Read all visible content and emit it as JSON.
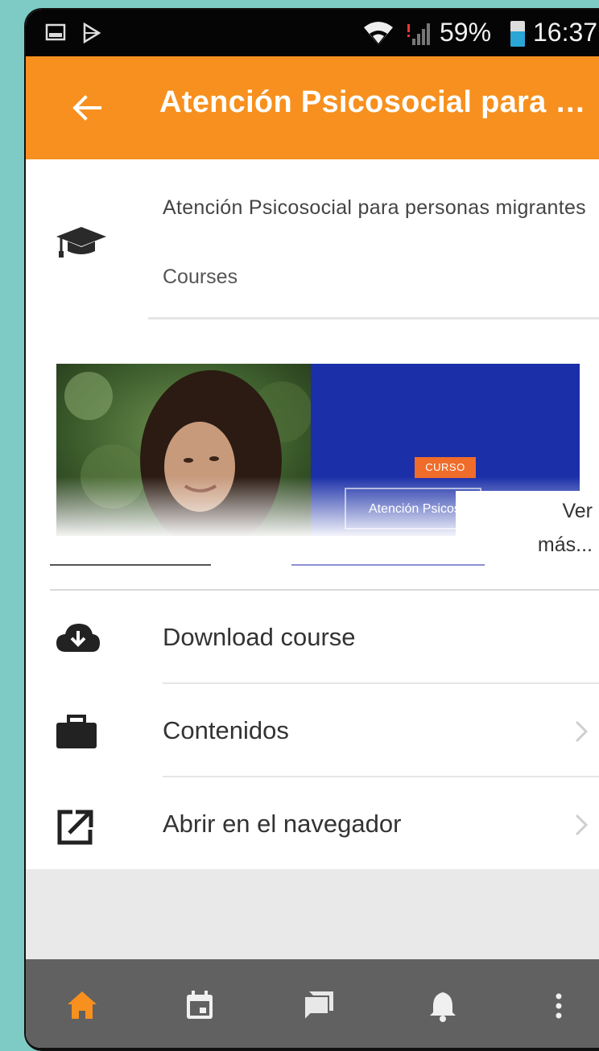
{
  "status_bar": {
    "battery_percent": "59%",
    "time": "16:37",
    "icons": [
      "gallery-icon",
      "play-store-icon",
      "wifi-icon",
      "signal-icon",
      "battery-icon"
    ]
  },
  "app_bar": {
    "back_icon": "arrow-left-icon",
    "title": "Atención Psicosocial para personas migrantes"
  },
  "course": {
    "icon": "graduation-cap-icon",
    "name": "Atención Psicosocial para personas migrantes",
    "category": "Courses"
  },
  "banner": {
    "badge": "CURSO",
    "caption": "Atención Psicosocial",
    "see_more": "Ver más..."
  },
  "list": {
    "items": [
      {
        "label": "Download course",
        "icon": "cloud-download-icon"
      },
      {
        "label": "Contenidos",
        "icon": "briefcase-icon"
      },
      {
        "label": "Abrir en el navegador",
        "icon": "external-link-icon"
      }
    ]
  },
  "bottom_nav": {
    "items": [
      "home-icon",
      "calendar-icon",
      "messages-icon",
      "notifications-icon",
      "more-icon"
    ]
  },
  "colors": {
    "app_bar": "#f7901e",
    "bottom_nav": "#616161",
    "active_nav": "#f7901e",
    "banner_blue": "#1b2fa8",
    "background": "#7ecbc6"
  }
}
